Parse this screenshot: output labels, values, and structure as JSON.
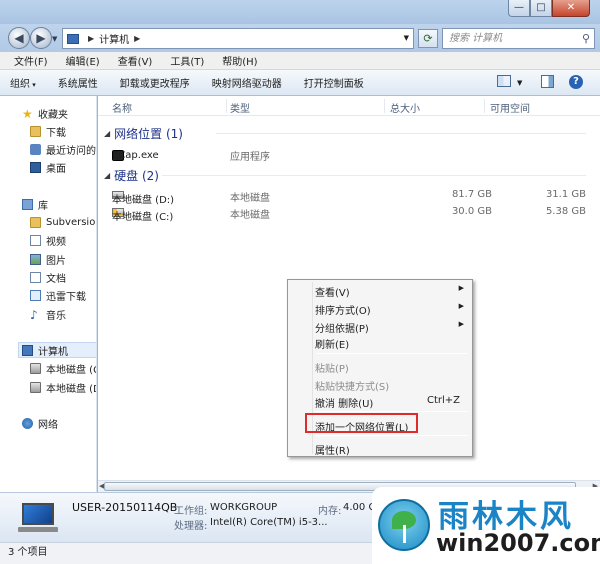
{
  "titlebar": {
    "min": "—",
    "max": "□",
    "close": "✕"
  },
  "address": {
    "segment": "计算机",
    "search_placeholder": "搜索 计算机"
  },
  "menu": [
    "文件(F)",
    "编辑(E)",
    "查看(V)",
    "工具(T)",
    "帮助(H)"
  ],
  "toolbar": [
    "组织",
    "系统属性",
    "卸载或更改程序",
    "映射网络驱动器",
    "打开控制面板"
  ],
  "nav": {
    "favorites": "收藏夹",
    "downloads": "下载",
    "recent": "最近访问的",
    "desktop": "桌面",
    "libraries": "库",
    "subversion": "Subversion",
    "videos": "视频",
    "pictures": "图片",
    "documents": "文档",
    "xunlei": "迅雷下载",
    "music": "音乐",
    "computer": "计算机",
    "disk_c": "本地磁盘 (C:)",
    "disk_d": "本地磁盘 (D:)",
    "network": "网络"
  },
  "columns": {
    "name": "名称",
    "type": "类型",
    "total": "总大小",
    "free": "可用空间"
  },
  "groups": {
    "network": "网络位置 (1)",
    "disks": "硬盘 (2)"
  },
  "rows": {
    "ecap": {
      "name": "ECap.exe",
      "type": "应用程序"
    },
    "d": {
      "name": "本地磁盘 (D:)",
      "type": "本地磁盘",
      "total": "81.7 GB",
      "free": "31.1 GB"
    },
    "c": {
      "name": "本地磁盘 (C:)",
      "type": "本地磁盘",
      "total": "30.0 GB",
      "free": "5.38 GB"
    }
  },
  "details": {
    "name": "USER-20150114QB",
    "workgroup_label": "工作组:",
    "workgroup": "WORKGROUP",
    "memory_label": "内存:",
    "memory": "4.00 G",
    "cpu_label": "处理器:",
    "cpu": "Intel(R) Core(TM) i5-3..."
  },
  "status": "3 个项目",
  "context_menu": {
    "view": "查看(V)",
    "sort": "排序方式(O)",
    "group": "分组依据(P)",
    "refresh": "刷新(E)",
    "paste": "粘贴(P)",
    "paste_shortcut": "粘贴快捷方式(S)",
    "undo": "撤消 删除(U)",
    "undo_shortcut": "Ctrl+Z",
    "add_network": "添加一个网络位置(L)",
    "properties": "属性(R)"
  },
  "watermark": {
    "title": "雨林木风",
    "site": "win2007.com"
  }
}
